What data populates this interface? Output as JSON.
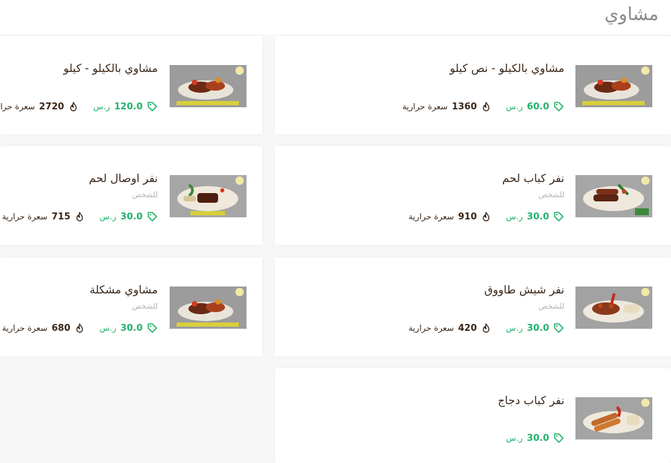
{
  "section": {
    "title": "مشاوي"
  },
  "currency": "ر.س",
  "calories_label": "سعرة حرارية",
  "colors": {
    "accent": "#21b36b",
    "text": "#3a2618",
    "muted": "#b5b5b5"
  },
  "icons": {
    "price": "tag-icon",
    "calories": "flame-icon"
  },
  "items": [
    {
      "name": "مشاوي بالكيلو - نص كيلو",
      "subtitle": "",
      "price": "60.0",
      "calories": "1360"
    },
    {
      "name": "مشاوي بالكيلو - كيلو",
      "subtitle": "",
      "price": "120.0",
      "calories": "2720"
    },
    {
      "name": "نفر كباب لحم",
      "subtitle": "للشخص",
      "price": "30.0",
      "calories": "910"
    },
    {
      "name": "نفر اوصال لحم",
      "subtitle": "للشخص",
      "price": "30.0",
      "calories": "715"
    },
    {
      "name": "نفر شيش طاووق",
      "subtitle": "للشخص",
      "price": "30.0",
      "calories": "420"
    },
    {
      "name": "مشاوي مشكلة",
      "subtitle": "للشخص",
      "price": "30.0",
      "calories": "680"
    },
    {
      "name": "نفر كباب دجاج",
      "subtitle": "",
      "price": "30.0",
      "calories": ""
    }
  ]
}
